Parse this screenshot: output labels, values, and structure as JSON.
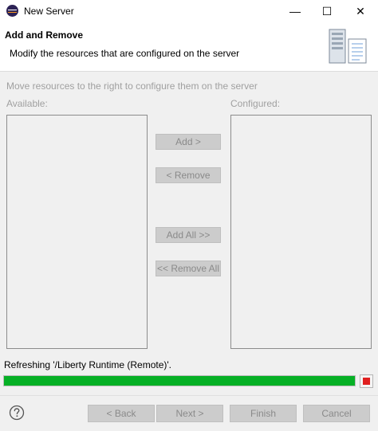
{
  "window": {
    "title": "New Server",
    "icon": "eclipse-icon",
    "controls": {
      "minimize": "—",
      "maximize": "☐",
      "close": "✕"
    }
  },
  "banner": {
    "title": "Add and Remove",
    "description": "Modify the resources that are configured on the server",
    "image": "server-wizard-icon"
  },
  "main": {
    "instruction": "Move resources to the right to configure them on the server",
    "available_label": "Available:",
    "configured_label": "Configured:",
    "available_items": [],
    "configured_items": []
  },
  "buttons": {
    "add": "Add >",
    "remove": "< Remove",
    "add_all": "Add All >>",
    "remove_all": "<< Remove All"
  },
  "status": {
    "text": "Refreshing '/Liberty Runtime (Remote)'.",
    "progress": 1.0,
    "progress_color": "#06b025",
    "stop_icon": "stop-icon"
  },
  "footer": {
    "help_icon": "help-icon",
    "back": "< Back",
    "next": "Next >",
    "finish": "Finish",
    "cancel": "Cancel"
  }
}
